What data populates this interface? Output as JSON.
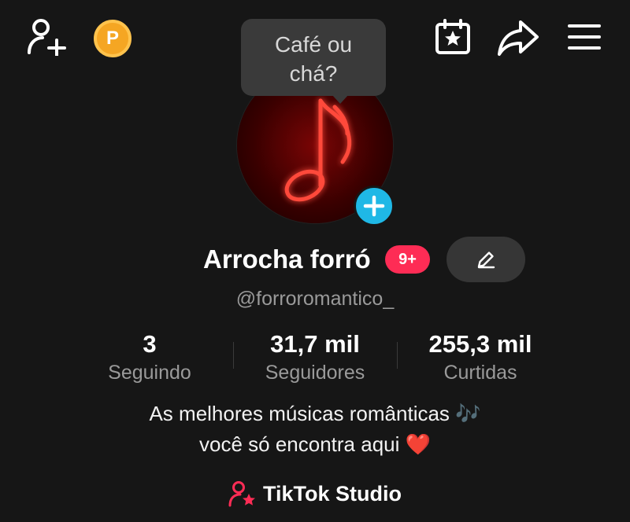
{
  "tooltip": {
    "line1": "Café ou",
    "line2": "chá?"
  },
  "header": {
    "points_badge": "P",
    "icons": [
      "add-friend-icon",
      "points-icon",
      "calendar-star-icon",
      "share-icon",
      "menu-icon"
    ]
  },
  "profile": {
    "name": "Arrocha forró",
    "notification_badge": "9+",
    "handle": "@forroromantico_"
  },
  "stats": [
    {
      "value": "3",
      "label": "Seguindo"
    },
    {
      "value": "31,7 mil",
      "label": "Seguidores"
    },
    {
      "value": "255,3 mil",
      "label": "Curtidas"
    }
  ],
  "bio": {
    "line1": "As melhores músicas românticas 🎶",
    "line2": "você só encontra aqui ❤️"
  },
  "studio_link": {
    "label": "TikTok Studio"
  },
  "colors": {
    "background": "#161616",
    "accent_pink": "#fe2c55",
    "add_blue": "#1fb8e6",
    "points_gold": "#f5a623"
  }
}
